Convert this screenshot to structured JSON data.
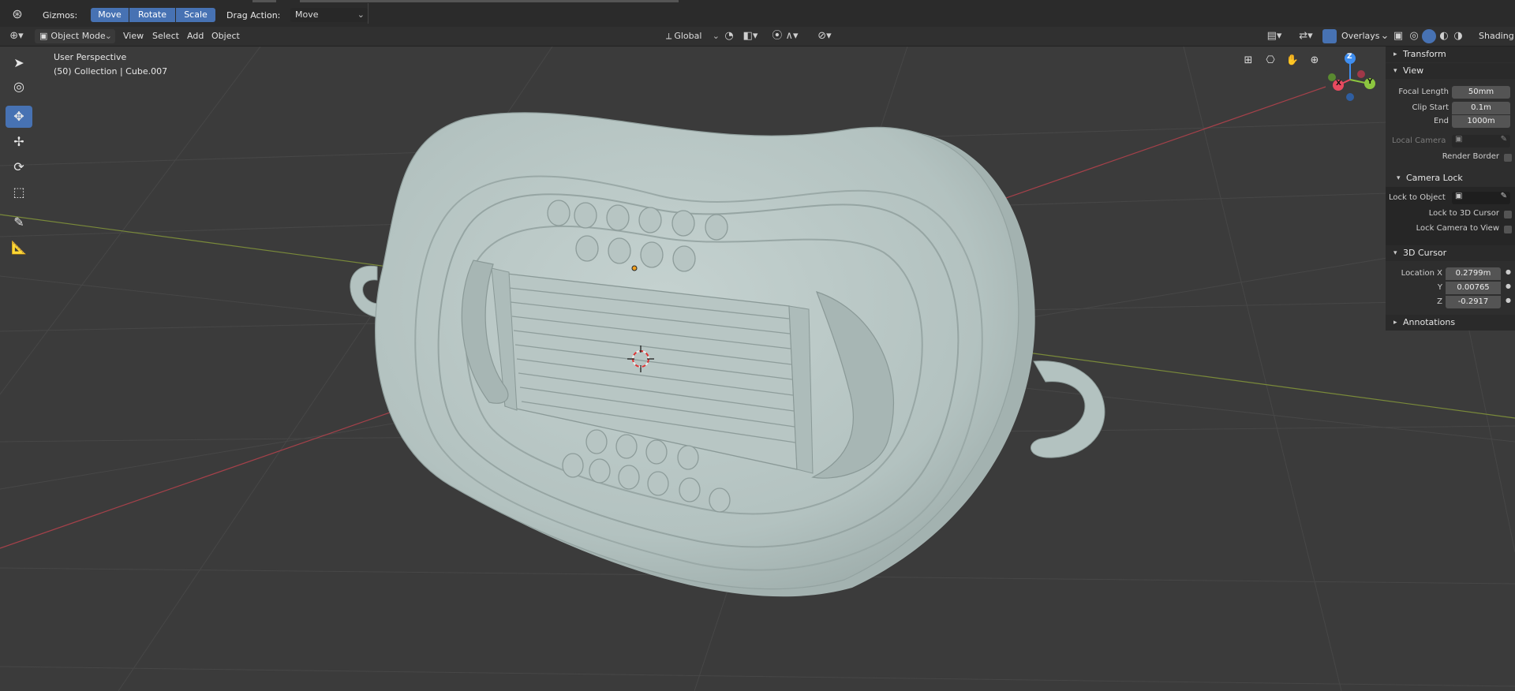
{
  "topbar": {
    "gizmos_label": "Gizmos:",
    "move": "Move",
    "rotate": "Rotate",
    "scale": "Scale",
    "drag_label": "Drag Action:",
    "drag_value": "Move"
  },
  "header": {
    "mode": "Object Mode",
    "menus": [
      "View",
      "Select",
      "Add",
      "Object"
    ],
    "transform_orientation": "Global",
    "overlays": "Overlays",
    "shading": "Shading"
  },
  "viewport": {
    "perspective": "User Perspective",
    "collection": "(50) Collection | Cube.007",
    "gizmo_axes": {
      "x": "X",
      "y": "Y",
      "z": "Z"
    }
  },
  "npanel": {
    "transform": "Transform",
    "view": "View",
    "focal_length_label": "Focal Length",
    "focal_length": "50mm",
    "clip_start_label": "Clip Start",
    "clip_start": "0.1m",
    "end_label": "End",
    "end": "1000m",
    "local_camera_label": "Local Camera",
    "render_border_label": "Render Border",
    "camera_lock": "Camera Lock",
    "lock_to_object_label": "Lock to Object",
    "lock_to_3d_cursor_label": "Lock to 3D Cursor",
    "lock_camera_to_view_label": "Lock Camera to View",
    "cursor_3d": "3D Cursor",
    "location_x_label": "Location X",
    "location_x": "0.2799m",
    "y_label": "Y",
    "y": "0.00765",
    "z_label": "Z",
    "z": "-0.2917",
    "annotations": "Annotations"
  },
  "colors": {
    "accent": "#4772b3",
    "model": "#b3c2c0",
    "x_axis": "#e84a5f",
    "y_axis": "#8cc63f",
    "z_axis": "#3f8ef0"
  }
}
